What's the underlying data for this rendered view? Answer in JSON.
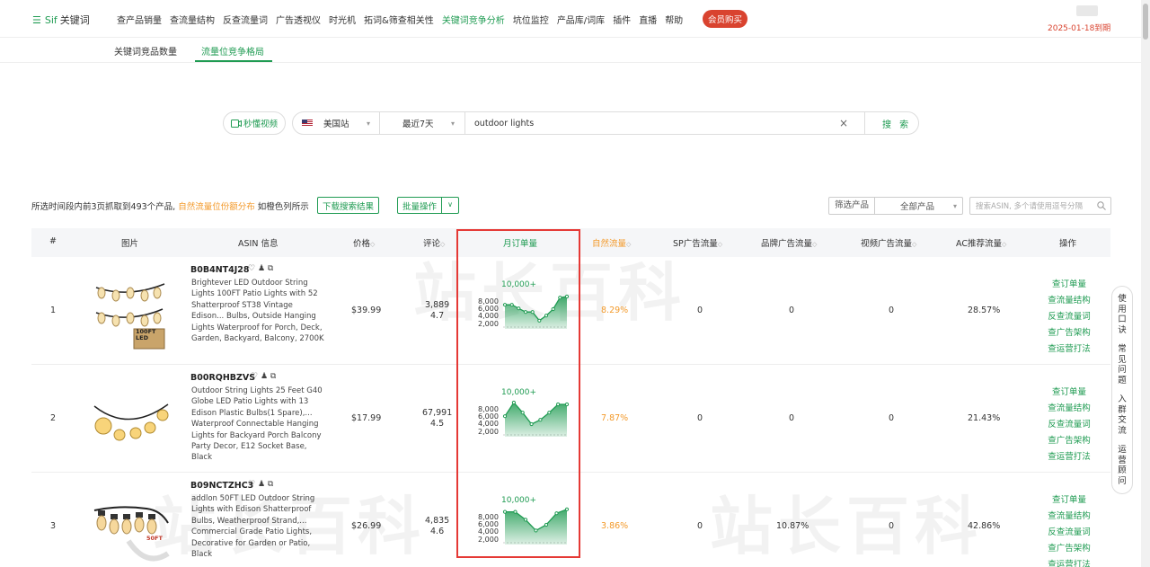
{
  "topnav": {
    "logo_sif": "Sif",
    "logo_text": "关键词",
    "menu": [
      "查产品销量",
      "查流量结构",
      "反查流量词",
      "广告透视仪",
      "时光机",
      "拓词&筛查相关性",
      "关键词竞争分析",
      "坑位监控",
      "产品库/词库",
      "插件",
      "直播",
      "帮助"
    ],
    "active_menu": "关键词竞争分析",
    "vip_label": "会员购买",
    "expire": "2025-01-18到期"
  },
  "subnav": {
    "tab_a": "关键词竞品数量",
    "tab_b": "流量位竞争格局"
  },
  "search": {
    "video_label": "秒懂视频",
    "site": "美国站",
    "period": "最近7天",
    "keyword": "outdoor lights",
    "search_label": "搜 索"
  },
  "info": {
    "text_a": "所选时间段内前3页抓取到493个产品,",
    "text_orange": "自然流量位份额分布",
    "text_b": "如橙色列所示",
    "download_label": "下载搜索结果",
    "batch_label": "批量操作",
    "filter_label": "筛选产品",
    "filter_value": "全部产品",
    "asin_search_placeholder": "搜索ASIN, 多个请使用逗号分隔"
  },
  "table": {
    "headers": {
      "num": "#",
      "image": "图片",
      "asin": "ASIN 信息",
      "price": "价格",
      "reviews": "评论",
      "monthly": "月订单量",
      "organic": "自然流量",
      "sp": "SP广告流量",
      "brand": "品牌广告流量",
      "video": "视频广告流量",
      "ac": "AC推荐流量",
      "ops": "操作"
    },
    "rows": [
      {
        "num": "1",
        "asin": "B0B4NT4J28",
        "desc": "Brightever LED Outdoor String Lights 100FT Patio Lights with 52 Shatterproof ST38 Vintage Edison... Bulbs, Outside Hanging Lights Waterproof for Porch, Deck, Garden, Backyard, Balcony, 2700K",
        "price": "$39.99",
        "reviews": "3,889",
        "rating": "4.7",
        "spark_top": "10,000+",
        "organic": "8.29%",
        "sp": "0",
        "brand": "0",
        "video": "0",
        "ac": "28.57%",
        "img_label": "100FT LED"
      },
      {
        "num": "2",
        "asin": "B00RQHBZVS",
        "desc": "Outdoor String Lights 25 Feet G40 Globe LED Patio Lights with 13 Edison Plastic Bulbs(1 Spare),... Waterproof Connectable Hanging Lights for Backyard Porch Balcony Party Decor, E12 Socket Base, Black",
        "price": "$17.99",
        "reviews": "67,991",
        "rating": "4.5",
        "spark_top": "10,000+",
        "organic": "7.87%",
        "sp": "0",
        "brand": "0",
        "video": "0",
        "ac": "21.43%",
        "img_label": ""
      },
      {
        "num": "3",
        "asin": "B09NCTZHC3",
        "desc": "addlon 50FT LED Outdoor String Lights with Edison Shatterproof Bulbs, Weatherproof Strand,... Commercial Grade Patio Lights, Decorative for Garden or Patio, Black",
        "price": "$26.99",
        "reviews": "4,835",
        "rating": "4.6",
        "spark_top": "10,000+",
        "organic": "3.86%",
        "sp": "0",
        "brand": "10.87%",
        "video": "0",
        "ac": "42.86%",
        "img_label": "50FT"
      }
    ],
    "ops": [
      "查订单量",
      "查流量结构",
      "反查流量词",
      "查广告架构",
      "查运营打法"
    ],
    "spark_ticks": [
      "8,000",
      "6,000",
      "4,000",
      "2,000"
    ]
  },
  "side_panel": {
    "items": [
      "使用口诀",
      "常见问题",
      "入群交流",
      "运营顾问"
    ]
  },
  "colors": {
    "brand_green": "#1f9b52",
    "orange": "#f39a2b",
    "highlight_red": "#e53935"
  }
}
